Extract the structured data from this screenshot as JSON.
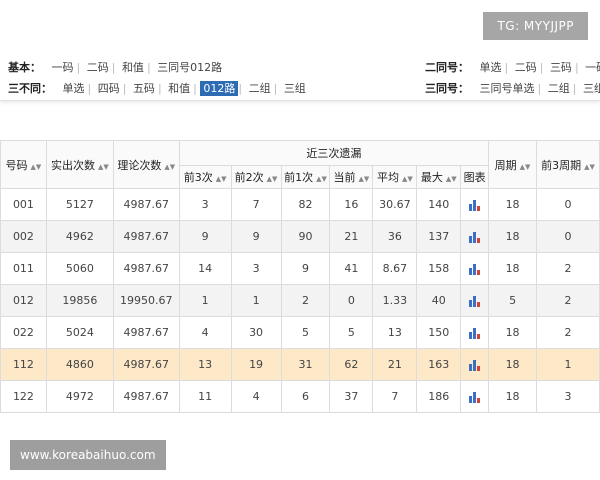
{
  "watermark_tg": "TG: MYYJJPP",
  "watermark_site": "www.koreabaihuo.com",
  "colors": {
    "active_tab": "#2d6bb5",
    "highlight_row": "#fde8c8",
    "chart_blue": "#3a6fc4",
    "chart_red": "#d0453b"
  },
  "filters": {
    "basic": {
      "label": "基本：",
      "options": [
        "一码",
        "二码",
        "和值",
        "三同号012路"
      ]
    },
    "twosame": {
      "label": "二同号：",
      "options": [
        "单选",
        "二码",
        "三码",
        "一码"
      ]
    },
    "threediff": {
      "label": "三不同：",
      "options": [
        "单选",
        "四码",
        "五码",
        "和值",
        "012路",
        "二组",
        "三组"
      ],
      "active": "012路"
    },
    "threesame": {
      "label": "三同号：",
      "options": [
        "三同号单选",
        "二组",
        "三组"
      ]
    }
  },
  "table": {
    "headers": {
      "code": "号码",
      "actual": "实出次数",
      "theory": "理论次数",
      "recent3": "近三次遗漏",
      "cycle": "周期",
      "prev3cycle": "前3周期",
      "sub": [
        "前3次",
        "前2次",
        "前1次",
        "当前",
        "平均",
        "最大",
        "图表"
      ]
    },
    "rows": [
      {
        "code": "001",
        "actual": "5127",
        "theory": "4987.67",
        "p3": "3",
        "p2": "7",
        "p1": "82",
        "cur": "16",
        "avg": "30.67",
        "max": "140",
        "cycle": "18",
        "prev3": "0",
        "chart_icon": "bar-chart-icon"
      },
      {
        "code": "002",
        "actual": "4962",
        "theory": "4987.67",
        "p3": "9",
        "p2": "9",
        "p1": "90",
        "cur": "21",
        "avg": "36",
        "max": "137",
        "cycle": "18",
        "prev3": "0",
        "chart_icon": "bar-chart-icon"
      },
      {
        "code": "011",
        "actual": "5060",
        "theory": "4987.67",
        "p3": "14",
        "p2": "3",
        "p1": "9",
        "cur": "41",
        "avg": "8.67",
        "max": "158",
        "cycle": "18",
        "prev3": "2",
        "chart_icon": "bar-chart-icon"
      },
      {
        "code": "012",
        "actual": "19856",
        "theory": "19950.67",
        "p3": "1",
        "p2": "1",
        "p1": "2",
        "cur": "0",
        "avg": "1.33",
        "max": "40",
        "cycle": "5",
        "prev3": "2",
        "chart_icon": "bar-chart-icon"
      },
      {
        "code": "022",
        "actual": "5024",
        "theory": "4987.67",
        "p3": "4",
        "p2": "30",
        "p1": "5",
        "cur": "5",
        "avg": "13",
        "max": "150",
        "cycle": "18",
        "prev3": "2",
        "chart_icon": "bar-chart-icon"
      },
      {
        "code": "112",
        "actual": "4860",
        "theory": "4987.67",
        "p3": "13",
        "p2": "19",
        "p1": "31",
        "cur": "62",
        "avg": "21",
        "max": "163",
        "cycle": "18",
        "prev3": "1",
        "chart_icon": "bar-chart-icon",
        "highlight": true
      },
      {
        "code": "122",
        "actual": "4972",
        "theory": "4987.67",
        "p3": "11",
        "p2": "4",
        "p1": "6",
        "cur": "37",
        "avg": "7",
        "max": "186",
        "cycle": "18",
        "prev3": "3",
        "chart_icon": "bar-chart-icon"
      }
    ]
  }
}
